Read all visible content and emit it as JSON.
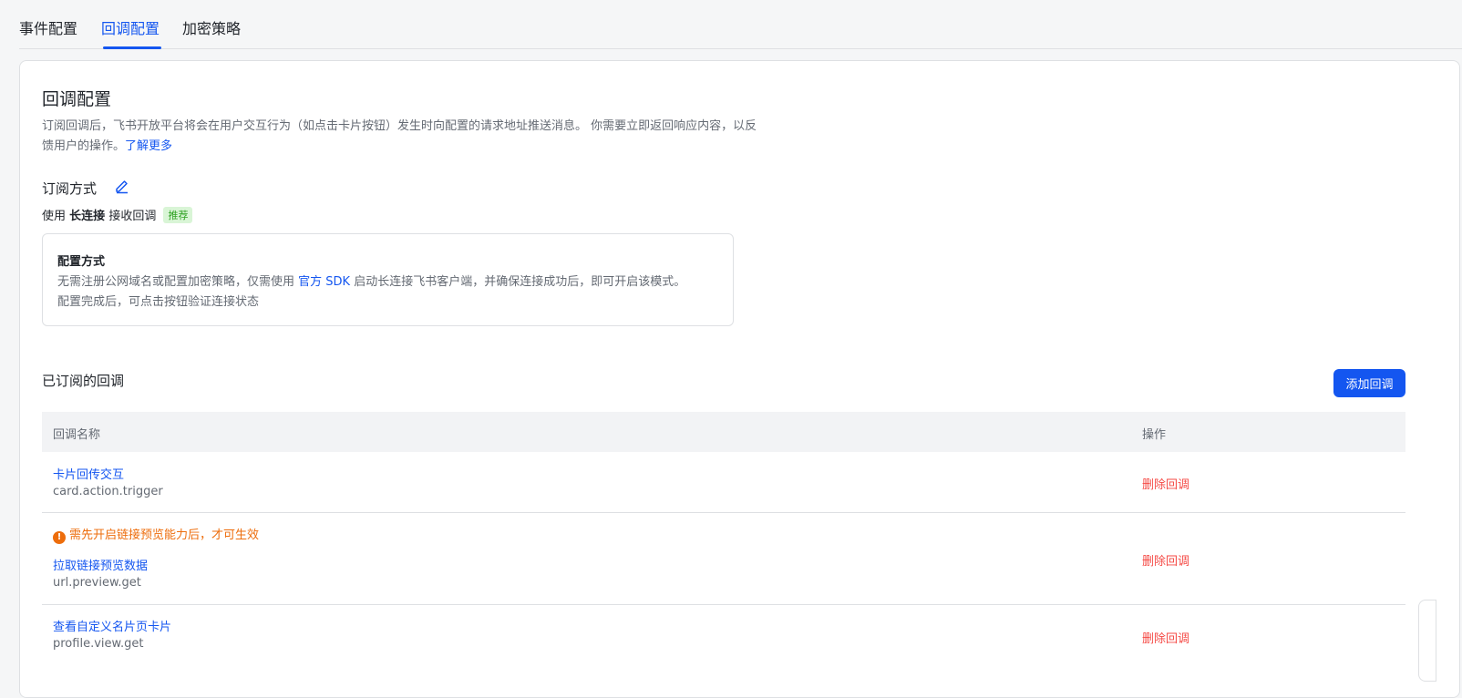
{
  "tabs": [
    {
      "label": "事件配置"
    },
    {
      "label": "回调配置"
    },
    {
      "label": "加密策略"
    }
  ],
  "active_tab": "回调配置",
  "page": {
    "title": "回调配置",
    "description": "订阅回调后，飞书开放平台将会在用户交互行为（如点击卡片按钮）发生时向配置的请求地址推送消息。 你需要立即返回响应内容，以反馈用户的操作。",
    "learn_more": "了解更多"
  },
  "subscription": {
    "title": "订阅方式",
    "edit_icon": "pencil-icon",
    "mode_prefix": "使用",
    "mode_name": "长连接",
    "mode_suffix": "接收回调",
    "badge": "推荐"
  },
  "config_box": {
    "title": "配置方式",
    "text_before": "无需注册公网域名或配置加密策略，仅需使用",
    "sdk_link": "官方 SDK",
    "text_after": "启动长连接飞书客户端，并确保连接成功后，即可开启该模式。",
    "text_line2": "配置完成后，可点击按钮验证连接状态"
  },
  "subscribed": {
    "title": "已订阅的回调",
    "add_button": "添加回调",
    "columns": {
      "name": "回调名称",
      "action": "操作"
    },
    "rows": [
      {
        "name": "卡片回传交互",
        "key": "card.action.trigger",
        "action": "删除回调",
        "warning": ""
      },
      {
        "name": "拉取链接预览数据",
        "key": "url.preview.get",
        "action": "删除回调",
        "warning": "需先开启链接预览能力后，才可生效"
      },
      {
        "name": "查看自定义名片页卡片",
        "key": "profile.view.get",
        "action": "删除回调",
        "warning": ""
      }
    ]
  },
  "colors": {
    "primary": "#1456f0",
    "danger": "#f54a45",
    "warning": "#ed6d0c",
    "badge_bg": "#d9f5d6",
    "badge_text": "#2ea121"
  }
}
